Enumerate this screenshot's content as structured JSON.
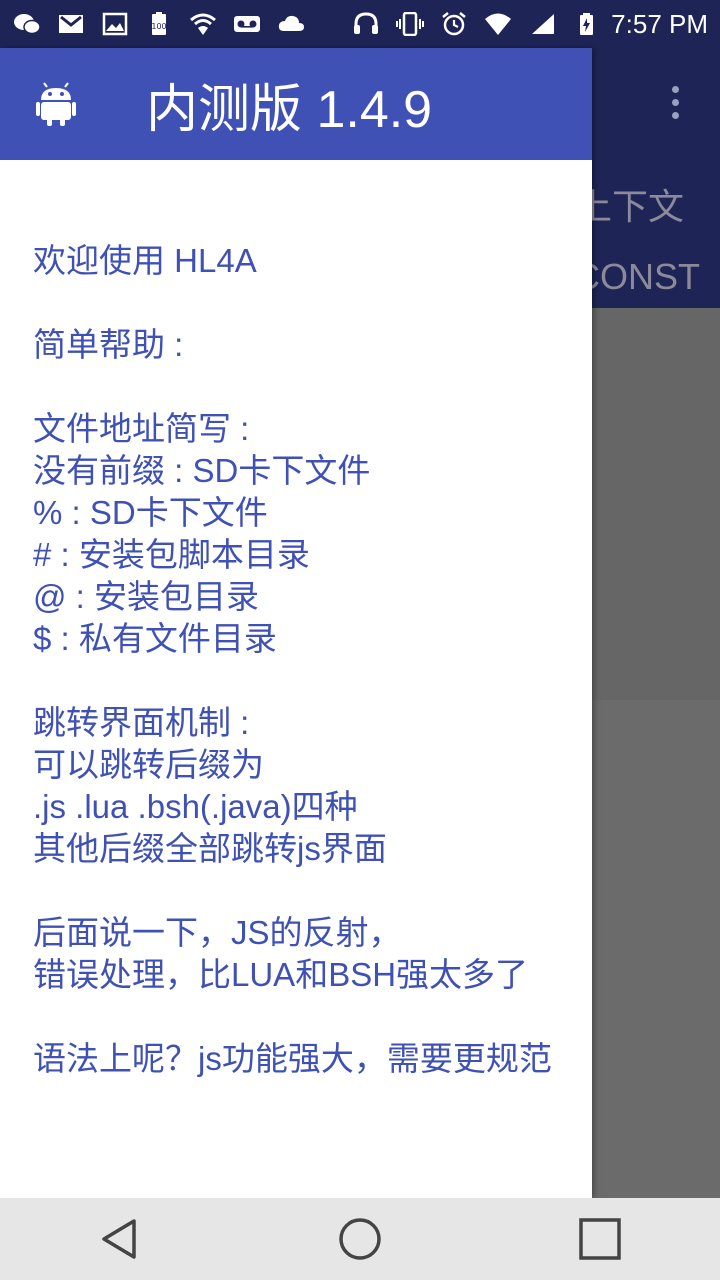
{
  "status_bar": {
    "time": "7:57 PM",
    "left_icons": [
      "wechat-icon",
      "gmail-icon",
      "image-icon",
      "battery-100-icon",
      "vpn-shield-icon",
      "voicemail-icon",
      "cloud-icon"
    ],
    "right_icons": [
      "headset-icon",
      "vibrate-icon",
      "alarm-icon",
      "wifi-icon",
      "signal-icon",
      "battery-charging-icon"
    ],
    "background": "#1e2456"
  },
  "drawer": {
    "title": "内测版 1.4.9",
    "header_color": "#3f51b5",
    "text_color": "#3f51b5",
    "icon": "android-icon",
    "lines": [
      "欢迎使用 HL4A",
      "",
      "简单帮助 :",
      "",
      "文件地址简写 :",
      "没有前缀 : SD卡下文件",
      "% : SD卡下文件",
      "# : 安装包脚本目录",
      "@ : 安装包目录",
      "$ : 私有文件目录",
      "",
      "跳转界面机制 :",
      "可以跳转后缀为",
      ".js .lua .bsh(.java)四种",
      "其他后缀全部跳转js界面",
      "",
      "后面说一下，JS的反射，",
      "错误处理，比LUA和BSH强太多了",
      "",
      "语法上呢？js功能强大，需要更规范"
    ]
  },
  "background_app": {
    "tab_1": "上下文",
    "tab_2": "CONST",
    "menu_icon": "overflow-menu-icon",
    "appbar_color": "#1e2456"
  },
  "nav_bar": {
    "buttons": [
      "back-icon",
      "home-icon",
      "recents-icon"
    ],
    "background": "#e6e6e6"
  }
}
